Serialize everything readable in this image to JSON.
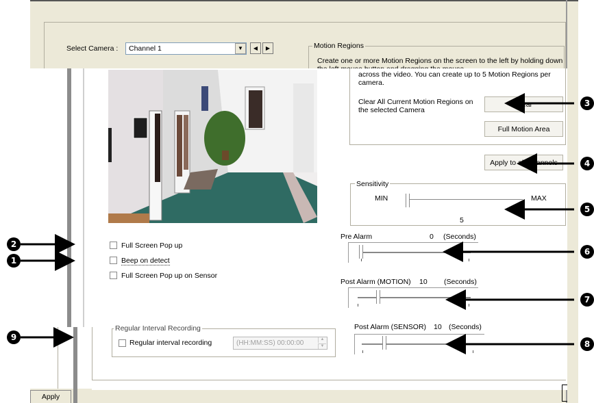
{
  "camera": {
    "label": "Select Camera :",
    "selected": "Channel 1",
    "prev_glyph": "◀",
    "next_glyph": "▶",
    "dropdown_glyph": "▼"
  },
  "motion_regions": {
    "title": "Motion Regions",
    "description_top": "Create one or more Motion Regions on the screen to the left by holding down the left mouse button and dragging the mouse",
    "description_bottom": "across the video. You can create up to 5 Motion Regions per camera.",
    "clear_label": "Clear All Current Motion Regions on the selected Camera",
    "clear_button": "Clear",
    "full_motion_button": "Full Motion Area"
  },
  "apply_all_button": "Apply to all Channels",
  "sensitivity": {
    "title": "Sensitivity",
    "min_label": "MIN",
    "max_label": "MAX",
    "value": "5"
  },
  "pre_alarm": {
    "label": "Pre Alarm",
    "value": "0",
    "unit": "(Seconds)",
    "level": 0.0
  },
  "post_alarm_motion": {
    "label": "Post Alarm (MOTION)",
    "value": "10",
    "unit": "(Seconds)",
    "level": 0.17
  },
  "post_alarm_sensor": {
    "label": "Post Alarm (SENSOR)",
    "value": "10",
    "unit": "(Seconds)",
    "level": 0.17
  },
  "options": [
    {
      "label": "Full Screen Pop up",
      "checked": false
    },
    {
      "label": "Beep on detect",
      "checked": false
    },
    {
      "label": "Full Screen Pop up on Sensor",
      "checked": false
    }
  ],
  "regular_interval": {
    "title": "Regular Interval Recording",
    "checkbox_label": "Regular interval recording",
    "time_value": "(HH:MM:SS)   00:00:00"
  },
  "apply_button": "Apply",
  "callouts": [
    "1",
    "2",
    "3",
    "4",
    "5",
    "6",
    "7",
    "8",
    "9"
  ],
  "colors": {
    "dialog_bg": "#ece9d8",
    "callout": "#000000",
    "video_floor": "#2f6b63",
    "video_wall": "#e8e6e6"
  }
}
